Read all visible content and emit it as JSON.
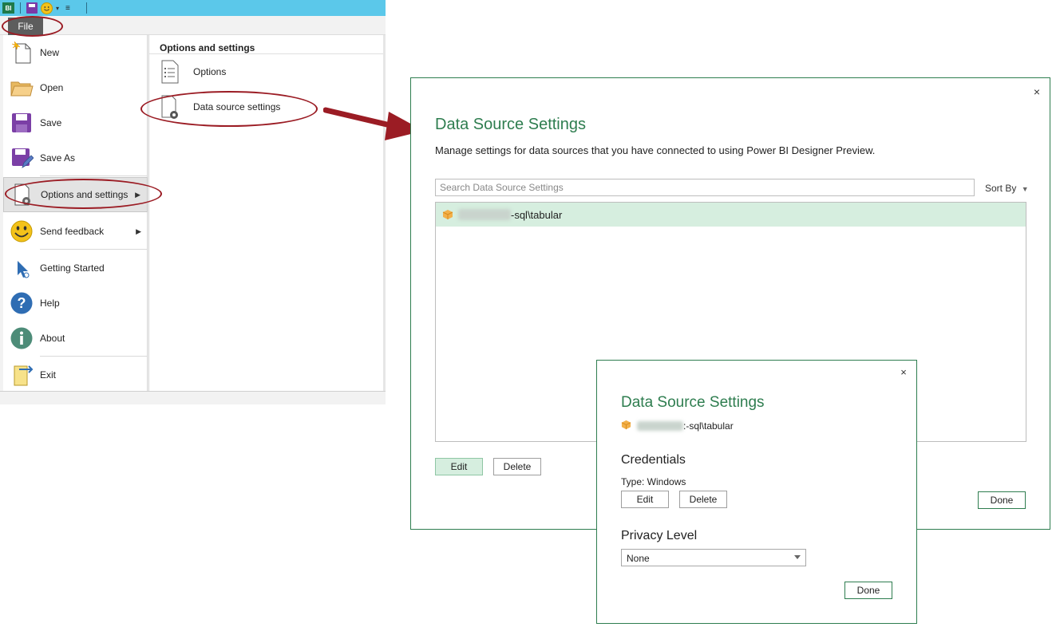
{
  "app": {
    "qat": {
      "app_label": "BI"
    },
    "file_tab": "File",
    "menu": {
      "items": [
        {
          "label": "New",
          "icon": "new-document-icon"
        },
        {
          "label": "Open",
          "icon": "folder-open-icon"
        },
        {
          "label": "Save",
          "icon": "save-disk-icon"
        },
        {
          "label": "Save As",
          "icon": "save-as-icon"
        },
        {
          "label": "Options and settings",
          "icon": "options-gear-document-icon",
          "has_submenu": true
        },
        {
          "label": "Send feedback",
          "icon": "smiley-icon",
          "has_submenu": true
        },
        {
          "label": "Getting Started",
          "icon": "cursor-pointer-icon"
        },
        {
          "label": "Help",
          "icon": "help-question-icon"
        },
        {
          "label": "About",
          "icon": "info-icon"
        },
        {
          "label": "Exit",
          "icon": "exit-document-icon"
        }
      ]
    },
    "submenu": {
      "header": "Options and settings",
      "items": [
        {
          "label": "Options",
          "icon": "options-list-document-icon"
        },
        {
          "label": "Data source settings",
          "icon": "data-source-gear-document-icon"
        }
      ]
    }
  },
  "main_dialog": {
    "title": "Data Source Settings",
    "description": "Manage settings for data sources that you have connected to using Power BI Designer Preview.",
    "search_placeholder": "Search Data Source Settings",
    "sort_label": "Sort By",
    "sources": [
      {
        "name": "-sql\\tabular",
        "icon": "cube-icon"
      }
    ],
    "edit_label": "Edit",
    "delete_label": "Delete",
    "done_label": "Done",
    "close_label": "×"
  },
  "detail_dialog": {
    "title": "Data Source Settings",
    "source_name": ":-sql\\tabular",
    "credentials_heading": "Credentials",
    "credentials_type": "Type: Windows",
    "edit_label": "Edit",
    "delete_label": "Delete",
    "privacy_heading": "Privacy Level",
    "privacy_value": "None",
    "done_label": "Done",
    "close_label": "×"
  },
  "colors": {
    "accent_green": "#2e7d4f",
    "selected_row": "#d6eedf",
    "annotation_red": "#9b1c24",
    "title_bar": "#5bc8ea"
  }
}
